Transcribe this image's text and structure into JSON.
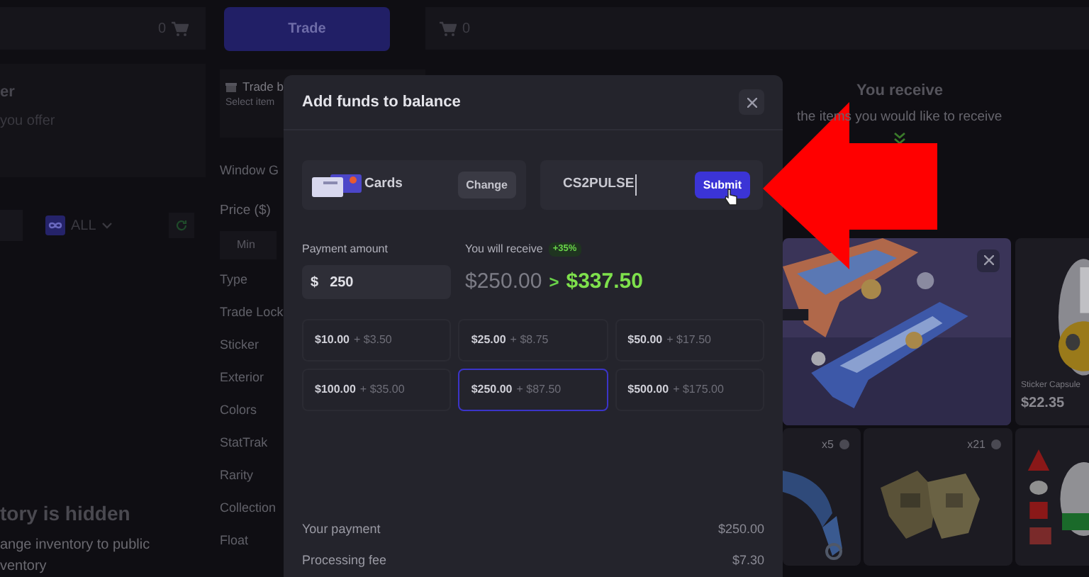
{
  "left_panel": {
    "cart_count": "0",
    "title": "er",
    "subtitle": "you offer",
    "filter": {
      "label": "ALL"
    },
    "notice": {
      "title": "tory is hidden",
      "lines": [
        "ange inventory to public",
        "ventory"
      ]
    }
  },
  "center_panel": {
    "trade_button": "Trade",
    "trade_bot": {
      "title": "Trade b",
      "hint": "Select item"
    },
    "window_label": "Window G",
    "price_label": "Price ($)",
    "min_placeholder": "Min",
    "filters": [
      "Type",
      "Trade Lock",
      "Sticker",
      "Exterior",
      "Colors",
      "StatTrak",
      "Rarity",
      "Collection",
      "Float"
    ]
  },
  "right_panel": {
    "cart_count": "0",
    "title": "You receive",
    "subtitle": "the items you would like to receive",
    "items": [
      {
        "kind": "featured"
      },
      {
        "kind": "capsule",
        "name": "Sticker Capsule",
        "price": "$22.35"
      },
      {
        "kind": "knife",
        "count": "x5"
      },
      {
        "kind": "gloves",
        "count": "x21"
      },
      {
        "kind": "logos"
      }
    ]
  },
  "modal": {
    "title": "Add funds to balance",
    "payment_method": {
      "label": "Cards",
      "change_button": "Change"
    },
    "promo": {
      "value": "CS2PULSE",
      "submit_button": "Submit"
    },
    "payment_amount": {
      "label": "Payment amount",
      "currency": "$",
      "value": "250"
    },
    "receive": {
      "label": "You will receive",
      "bonus": "+35%",
      "from": "$250.00",
      "arrow": ">",
      "to": "$337.50"
    },
    "presets": [
      {
        "amount": "$10.00",
        "bonus": "+ $3.50",
        "selected": false
      },
      {
        "amount": "$25.00",
        "bonus": "+ $8.75",
        "selected": false
      },
      {
        "amount": "$50.00",
        "bonus": "+ $17.50",
        "selected": false
      },
      {
        "amount": "$100.00",
        "bonus": "+ $35.00",
        "selected": false
      },
      {
        "amount": "$250.00",
        "bonus": "+ $87.50",
        "selected": true
      },
      {
        "amount": "$500.00",
        "bonus": "+ $175.00",
        "selected": false
      }
    ],
    "summary": [
      {
        "label": "Your payment",
        "value": "$250.00"
      },
      {
        "label": "Processing fee",
        "value": "$7.30"
      }
    ]
  }
}
